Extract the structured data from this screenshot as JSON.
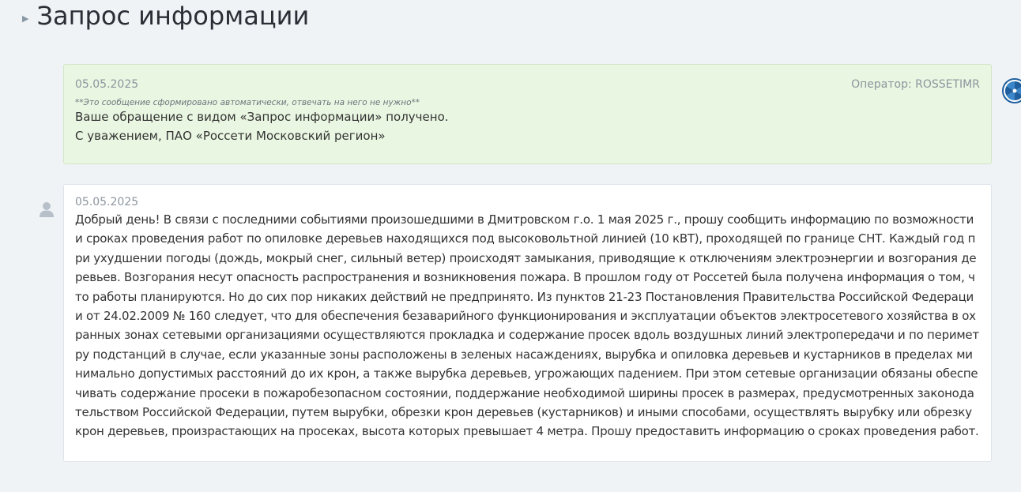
{
  "page": {
    "title": "Запрос информации"
  },
  "messages": [
    {
      "date": "05.05.2025",
      "operator_label": "Оператор: ROSSETIMR",
      "note": "**Это сообщение сформировано автоматически, отвечать на него не нужно**",
      "lines": [
        "Ваше обращение с видом «Запрос информации» получено.",
        "С уважением, ПАО «Россети Московский регион»"
      ],
      "avatar_icon": "rosseti-logo-icon"
    },
    {
      "date": "05.05.2025",
      "text": "Добрый день! В связи с последними событиями произошедшими в Дмитровском г.о. 1 мая 2025 г., прошу сообщить информацию по возможности и сроках проведения работ по опиловке деревьев находящихся под высоковольтной линией (10 кВТ), проходящей по границе СНТ. Каждый год при ухудшении погоды (дождь, мокрый снег, сильный ветер) происходят замыкания, приводящие к отключениям электроэнергии и возгорания деревьев. Возгорания несут опасность распространения и возникновения пожара. В прошлом году от Россетей была получена информация о том, что работы планируются. Но до сих пор никаких действий не предпринято. Из пунктов 21-23 Постановления Правительства Российской Федерации от 24.02.2009 № 160 следует, что для обеспечения безаварийного функционирования и эксплуатации объектов электросетевого хозяйства в охранных зонах сетевыми организациями осуществляются прокладка и содержание просек вдоль воздушных линий электропередачи и по периметру подстанций в случае, если указанные зоны расположены в зеленых насаждениях, вырубка и опиловка деревьев и кустарников в пределах минимально допустимых расстояний до их крон, а также вырубка деревьев, угрожающих падением. При этом сетевые организации обязаны обеспечивать содержание просеки в пожаробезопасном состоянии, поддержание необходимой ширины просек в размерах, предусмотренных законодательством Российской Федерации, путем вырубки, обрезки крон деревьев (кустарников) и иными способами, осуществлять вырубку или обрезку крон деревьев, произрастающих на просеках, высота которых превышает 4 метра. Прошу предоставить информацию о сроках проведения работ.",
      "avatar_icon": "user-avatar-icon"
    }
  ],
  "colors": {
    "operator_bg": "#e9f6e1",
    "user_bg": "#ffffff",
    "page_bg": "#f0f3f6",
    "logo_blue": "#1f5f9e"
  }
}
